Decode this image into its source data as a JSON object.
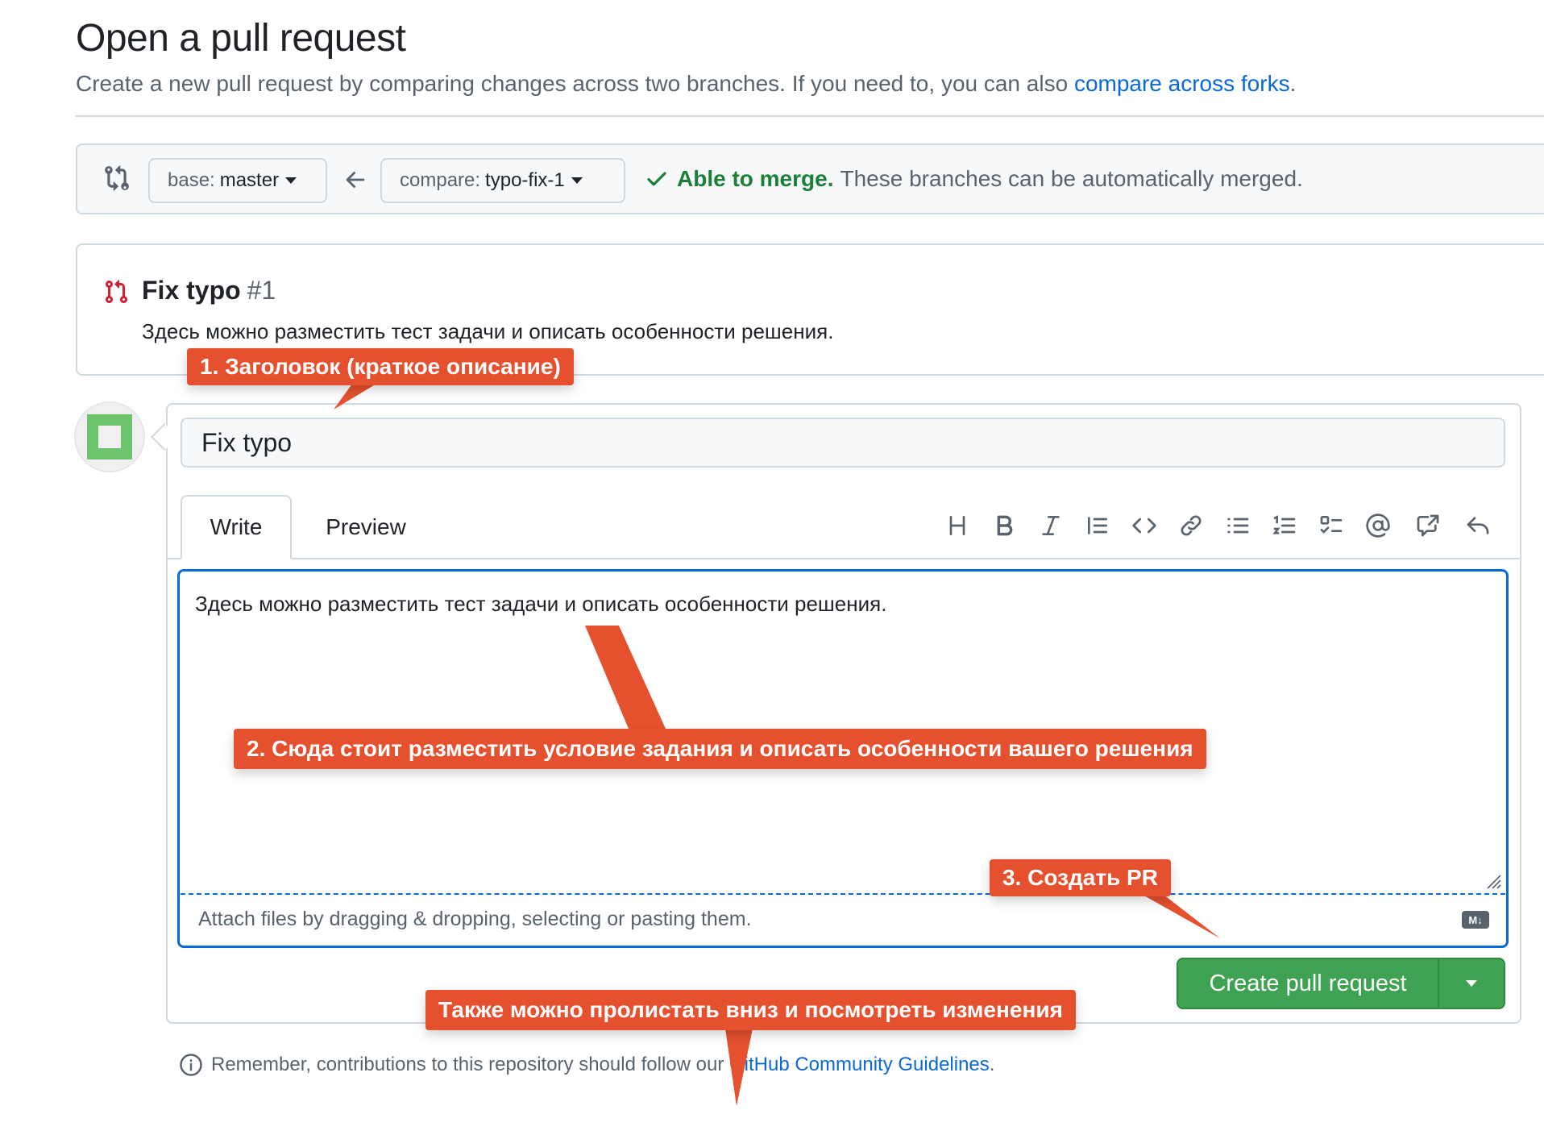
{
  "header": {
    "title": "Open a pull request",
    "subtitle": "Create a new pull request by comparing changes across two branches. If you need to, you can also",
    "subtitle_link": "compare across forks",
    "subtitle_end": "."
  },
  "compare": {
    "base_prefix": "base:",
    "base_value": "master",
    "compare_prefix": "compare:",
    "compare_value": "typo-fix-1",
    "merge_ok": "Able to merge.",
    "merge_msg": "These branches can be automatically merged."
  },
  "preview": {
    "title": "Fix typo",
    "number": "#1",
    "body": "Здесь можно разместить тест задачи и описать особенности решения."
  },
  "form": {
    "title_value": "Fix typo",
    "tabs": [
      "Write",
      "Preview"
    ],
    "body": "Здесь можно разместить тест задачи и описать особенности решения.",
    "attach_hint": "Attach files by dragging & dropping, selecting or pasting them.",
    "markdown_badge": "M↓",
    "submit_label": "Create pull request"
  },
  "toolbar": {
    "icons": [
      "heading-icon",
      "bold-icon",
      "italic-icon",
      "quote-icon",
      "code-icon",
      "link-icon",
      "bulleted-list-icon",
      "numbered-list-icon",
      "task-list-icon",
      "mention-icon",
      "cross-reference-icon",
      "reply-icon"
    ]
  },
  "footer": {
    "text": "Remember, contributions to this repository should follow our",
    "link": "GitHub Community Guidelines",
    "end": "."
  },
  "annotations": {
    "a1": "1. Заголовок (краткое описание)",
    "a2": "2. Сюда стоит разместить условие задания и описать особенности вашего решения",
    "a3": "3. Создать PR",
    "a4": "Также можно пролистать вниз и посмотреть изменения"
  },
  "colors": {
    "accent": "#0969da",
    "success": "#1a7f37",
    "submit": "#3fa253",
    "callout": "#e5512f",
    "pr_icon": "#cf222e"
  }
}
